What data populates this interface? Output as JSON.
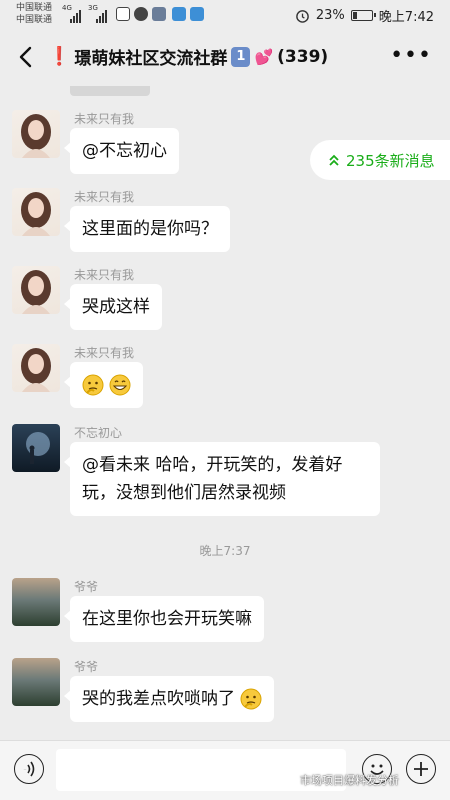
{
  "status_bar": {
    "carrier_1": "中国联通",
    "carrier_2": "中国联通",
    "network_1": "4G",
    "network_2": "3G",
    "battery_level": 0.23,
    "battery_text": "23%",
    "time": "晚上7:42",
    "icons": [
      "signal-icon",
      "sim-icon",
      "chat-bubble-icon",
      "app-icon",
      "alarm-icon",
      "battery-icon"
    ]
  },
  "header": {
    "title": "璟萌妹社区交流社群",
    "badge": "1",
    "member_count": "(339)",
    "title_prefix_icon": "exclamation-icon",
    "title_suffix_icon": "hearts-icon",
    "more_icon": "more-icon",
    "back_icon": "back-icon"
  },
  "new_messages": {
    "label": "235条新消息",
    "icon": "double-chevron-up-icon",
    "color": "#1aad19"
  },
  "messages": [
    {
      "sender": "未来只有我",
      "text": "@不忘初心",
      "avatar": "girl"
    },
    {
      "sender": "未来只有我",
      "text": "这里面的是你吗？",
      "avatar": "girl"
    },
    {
      "sender": "未来只有我",
      "text": "哭成这样",
      "avatar": "girl"
    },
    {
      "sender": "未来只有我",
      "text": "",
      "avatar": "girl",
      "emojis": [
        "thinking-emoji",
        "grin-emoji"
      ]
    },
    {
      "sender": "不忘初心",
      "text": "@看未来  哈哈，开玩笑的，发着好玩，没想到他们居然录视频",
      "avatar": "dark"
    },
    {
      "sender": "爷爷",
      "text": "在这里你也会开玩笑嘛",
      "avatar": "landscape"
    },
    {
      "sender": "爷爷",
      "text": "哭的我差点吹唢呐了",
      "avatar": "landscape",
      "emojis": [
        "thinking-emoji"
      ]
    }
  ],
  "time_separator": "晚上7:37",
  "input_bar": {
    "voice_icon": "voice-icon",
    "emoji_icon": "emoji-icon",
    "plus_icon": "plus-icon"
  },
  "watermark": "市场项目爆料发分析"
}
